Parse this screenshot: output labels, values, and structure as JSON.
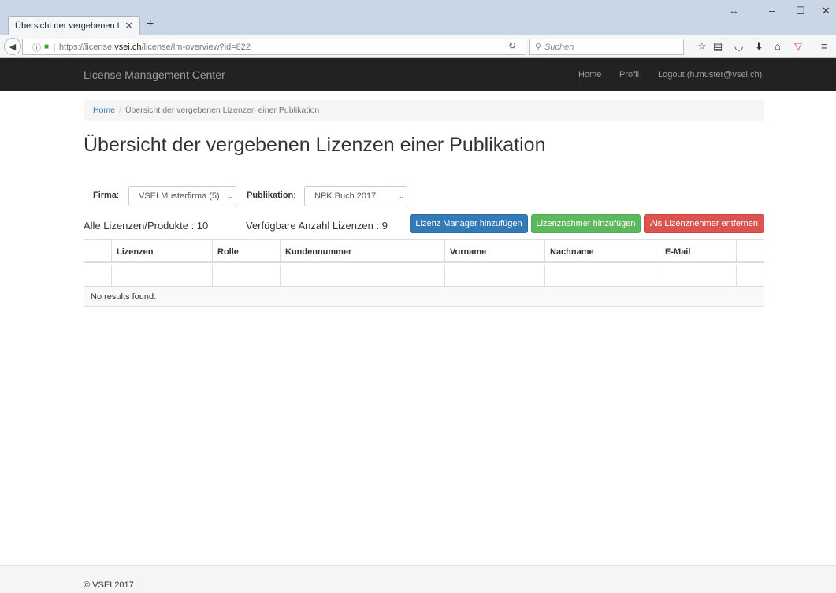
{
  "browser": {
    "tab_title": "Übersicht der vergebenen Lize...",
    "tab_close": "✕",
    "new_tab": "+",
    "url_prefix": "https://license.",
    "url_host": "vsei.ch",
    "url_path": "/license/lm-overview?id=822",
    "search_placeholder": "Suchen",
    "window_controls": [
      "↔",
      "–",
      "☐",
      "✕"
    ]
  },
  "site": {
    "brand": "License Management Center",
    "nav": [
      "Home",
      "Profil",
      "Logout (h.muster@vsei.ch)"
    ]
  },
  "breadcrumb": {
    "home": "Home",
    "divider": "/",
    "current": "Übersicht der vergebenen Lizenzen einer Publikation"
  },
  "page_title": "Übersicht der vergebenen Lizenzen einer Publikation",
  "filters": {
    "firma_label": "Firma",
    "firma_value": "VSEI Musterfirma (5)",
    "publikation_label": "Publikation",
    "publikation_value": "NPK Buch 2017"
  },
  "stats": {
    "all": "Alle Lizenzen/Produkte : 10",
    "available": "Verfügbare Anzahl Lizenzen : 9"
  },
  "buttons": {
    "add_manager": "Lizenz Manager hinzufügen",
    "add_licensee": "Lizenznehmer hinzufügen",
    "remove_licensee": "Als Lizenznehmer entfernen"
  },
  "table": {
    "columns": [
      "",
      "Lizenzen",
      "Rolle",
      "Kundennummer",
      "Vorname",
      "Nachname",
      "E-Mail",
      ""
    ],
    "empty_text": "No results found."
  },
  "footer": {
    "copyright": "© VSEI 2017"
  },
  "colors": {
    "primary": "#337ab7",
    "success": "#5cb85c",
    "danger": "#d9534f",
    "navbar": "#222222"
  }
}
